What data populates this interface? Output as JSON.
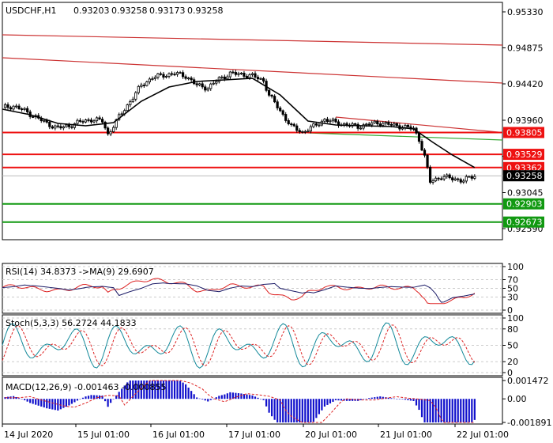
{
  "main": {
    "symbol": "USDCHF,H1",
    "ohlc": [
      "0.93203",
      "0.93258",
      "0.93173",
      "0.93258"
    ],
    "price_ticks": [
      "0.95330",
      "0.94875",
      "0.94420",
      "0.93960",
      "0.93505",
      "0.93045",
      "0.92590"
    ],
    "price_tags": [
      {
        "label": "0.93805",
        "value": 0.93805,
        "color": "#ee1111"
      },
      {
        "label": "0.93529",
        "value": 0.93529,
        "color": "#ee1111"
      },
      {
        "label": "0.93362",
        "value": 0.93362,
        "color": "#ee1111"
      },
      {
        "label": "0.93258",
        "value": 0.93258,
        "color": "#000000"
      },
      {
        "label": "0.92903",
        "value": 0.92903,
        "color": "#119911"
      },
      {
        "label": "0.92673",
        "value": 0.92673,
        "color": "#119911"
      }
    ]
  },
  "rsi": {
    "title": "RSI(14) 34.8373  ->MA(9) 29.6907",
    "ticks": [
      "100",
      "70",
      "50",
      "30",
      "0"
    ]
  },
  "stoch": {
    "title": "Stoch(5,3,3) 56.2724 44.1833",
    "ticks": [
      "100",
      "80",
      "50",
      "20",
      "0"
    ]
  },
  "macd": {
    "title": "MACD(12,26,9) -0.001463 -0.000855",
    "ticks": [
      "0.001472",
      "0.00",
      "-0.001891"
    ]
  },
  "time_labels": [
    "14 Jul 2020",
    "15 Jul 01:00",
    "16 Jul 01:00",
    "17 Jul 01:00",
    "20 Jul 01:00",
    "21 Jul 01:00",
    "22 Jul 01:00"
  ],
  "chart_data": {
    "type": "candlestick",
    "instrument": "USDCHF",
    "timeframe": "H1",
    "price_range": [
      0.9245,
      0.9545
    ],
    "close_path": [
      {
        "t": 0,
        "v": 0.9412
      },
      {
        "t": 4,
        "v": 0.9414
      },
      {
        "t": 8,
        "v": 0.9408
      },
      {
        "t": 12,
        "v": 0.94
      },
      {
        "t": 16,
        "v": 0.9392
      },
      {
        "t": 20,
        "v": 0.9386
      },
      {
        "t": 24,
        "v": 0.9389
      },
      {
        "t": 28,
        "v": 0.9394
      },
      {
        "t": 32,
        "v": 0.9397
      },
      {
        "t": 36,
        "v": 0.9395
      },
      {
        "t": 38,
        "v": 0.9378
      },
      {
        "t": 42,
        "v": 0.94
      },
      {
        "t": 46,
        "v": 0.942
      },
      {
        "t": 50,
        "v": 0.944
      },
      {
        "t": 54,
        "v": 0.945
      },
      {
        "t": 58,
        "v": 0.9453
      },
      {
        "t": 62,
        "v": 0.9455
      },
      {
        "t": 66,
        "v": 0.9452
      },
      {
        "t": 70,
        "v": 0.944
      },
      {
        "t": 74,
        "v": 0.9437
      },
      {
        "t": 78,
        "v": 0.9448
      },
      {
        "t": 82,
        "v": 0.9455
      },
      {
        "t": 86,
        "v": 0.9454
      },
      {
        "t": 90,
        "v": 0.9452
      },
      {
        "t": 94,
        "v": 0.9446
      },
      {
        "t": 96,
        "v": 0.9428
      },
      {
        "t": 100,
        "v": 0.9408
      },
      {
        "t": 104,
        "v": 0.9388
      },
      {
        "t": 108,
        "v": 0.9381
      },
      {
        "t": 112,
        "v": 0.9388
      },
      {
        "t": 116,
        "v": 0.9397
      },
      {
        "t": 120,
        "v": 0.9393
      },
      {
        "t": 124,
        "v": 0.939
      },
      {
        "t": 128,
        "v": 0.9388
      },
      {
        "t": 132,
        "v": 0.9391
      },
      {
        "t": 136,
        "v": 0.9393
      },
      {
        "t": 140,
        "v": 0.939
      },
      {
        "t": 144,
        "v": 0.9388
      },
      {
        "t": 148,
        "v": 0.9385
      },
      {
        "t": 150,
        "v": 0.9372
      },
      {
        "t": 152,
        "v": 0.935
      },
      {
        "t": 154,
        "v": 0.9318
      },
      {
        "t": 158,
        "v": 0.9325
      },
      {
        "t": 162,
        "v": 0.9322
      },
      {
        "t": 166,
        "v": 0.932
      },
      {
        "t": 170,
        "v": 0.93258
      }
    ],
    "moving_average": [
      {
        "t": 0,
        "v": 0.941
      },
      {
        "t": 10,
        "v": 0.9403
      },
      {
        "t": 20,
        "v": 0.9392
      },
      {
        "t": 30,
        "v": 0.9389
      },
      {
        "t": 40,
        "v": 0.9393
      },
      {
        "t": 50,
        "v": 0.942
      },
      {
        "t": 60,
        "v": 0.9438
      },
      {
        "t": 70,
        "v": 0.9445
      },
      {
        "t": 80,
        "v": 0.9447
      },
      {
        "t": 90,
        "v": 0.9449
      },
      {
        "t": 100,
        "v": 0.9428
      },
      {
        "t": 110,
        "v": 0.9395
      },
      {
        "t": 120,
        "v": 0.939
      },
      {
        "t": 130,
        "v": 0.9389
      },
      {
        "t": 140,
        "v": 0.9388
      },
      {
        "t": 148,
        "v": 0.9385
      },
      {
        "t": 155,
        "v": 0.9368
      },
      {
        "t": 162,
        "v": 0.9352
      },
      {
        "t": 170,
        "v": 0.93362
      }
    ],
    "trend_lines": [
      {
        "color": "#cc3333",
        "from": {
          "t": 0,
          "v": 0.9504
        },
        "to": {
          "t": 180,
          "v": 0.9491
        }
      },
      {
        "color": "#cc3333",
        "from": {
          "t": 0,
          "v": 0.9475
        },
        "to": {
          "t": 180,
          "v": 0.9443
        }
      },
      {
        "color": "#cc3333",
        "from": {
          "t": 120,
          "v": 0.94
        },
        "to": {
          "t": 180,
          "v": 0.93805
        }
      },
      {
        "color": "#33aa33",
        "from": {
          "t": 110,
          "v": 0.938
        },
        "to": {
          "t": 180,
          "v": 0.9371
        }
      }
    ],
    "horizontal_levels": [
      0.93805,
      0.93529,
      0.93362,
      0.92903,
      0.92673
    ],
    "rsi": {
      "range": [
        0,
        100
      ],
      "levels": [
        70,
        50,
        30
      ],
      "last": 34.8373,
      "ma_last": 29.6907
    },
    "stoch": {
      "range": [
        0,
        100
      ],
      "levels": [
        80,
        50,
        20
      ],
      "k_last": 56.2724,
      "d_last": 44.1833
    },
    "macd": {
      "range": [
        -0.001891,
        0.001472
      ],
      "last": -0.001463,
      "signal_last": -0.000855
    }
  }
}
